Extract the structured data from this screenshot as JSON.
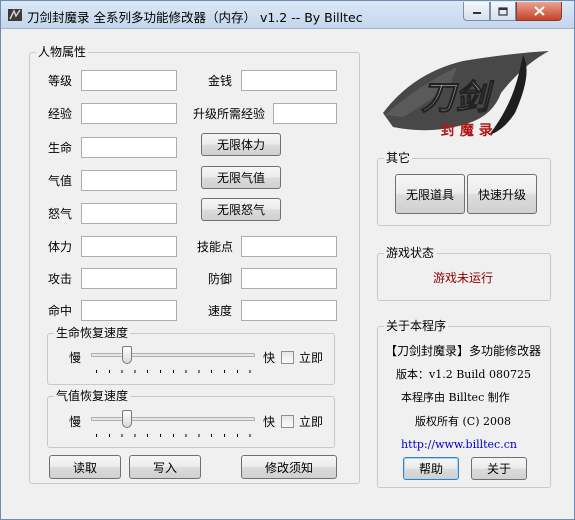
{
  "window": {
    "title": "刀剑封魔录 全系列多功能修改器（内存） v1.2 -- By Billtec",
    "app_icon": "game-cheat-icon",
    "controls": {
      "minimize_icon": "minimize-icon",
      "maximize_icon": "maximize-icon",
      "close_icon": "close-icon"
    }
  },
  "attributes": {
    "group_label": "人物属性",
    "fields": {
      "level": {
        "label": "等级",
        "value": ""
      },
      "money": {
        "label": "金钱",
        "value": ""
      },
      "exp": {
        "label": "经验",
        "value": ""
      },
      "exp_needed": {
        "label": "升级所需经验",
        "value": ""
      },
      "life": {
        "label": "生命",
        "value": ""
      },
      "qi": {
        "label": "气值",
        "value": ""
      },
      "rage": {
        "label": "怒气",
        "value": ""
      },
      "stamina": {
        "label": "体力",
        "value": ""
      },
      "skill_points": {
        "label": "技能点",
        "value": ""
      },
      "attack": {
        "label": "攻击",
        "value": ""
      },
      "defense": {
        "label": "防御",
        "value": ""
      },
      "accuracy": {
        "label": "命中",
        "value": ""
      },
      "speed": {
        "label": "速度",
        "value": ""
      }
    },
    "buttons": {
      "infinite_stamina": "无限体力",
      "infinite_qi": "无限气值",
      "infinite_rage": "无限怒气"
    }
  },
  "life_regen": {
    "group_label": "生命恢复速度",
    "slow": "慢",
    "fast": "快",
    "immediate": "立即",
    "immediate_checked": false,
    "level": 0.2
  },
  "qi_regen": {
    "group_label": "气值恢复速度",
    "slow": "慢",
    "fast": "快",
    "immediate": "立即",
    "immediate_checked": false,
    "level": 0.2
  },
  "actions": {
    "read": "读取",
    "write": "写入",
    "notes": "修改须知"
  },
  "logo": {
    "art_text": "刀剑",
    "sub_text": "封 魔 录"
  },
  "other": {
    "group_label": "其它",
    "infinite_items": "无限道具",
    "fast_level": "快速升级"
  },
  "game_status": {
    "group_label": "游戏状态",
    "text": "游戏未运行",
    "color": "#8b0000"
  },
  "about": {
    "group_label": "关于本程序",
    "name": "【刀剑封魔录】多功能修改器",
    "version": "版本：v1.2 Build 080725",
    "author": "本程序由 Billtec 制作",
    "copyright": "版权所有 (C) 2008",
    "url": "http://www.billtec.cn",
    "help": "帮助",
    "about": "关于"
  }
}
